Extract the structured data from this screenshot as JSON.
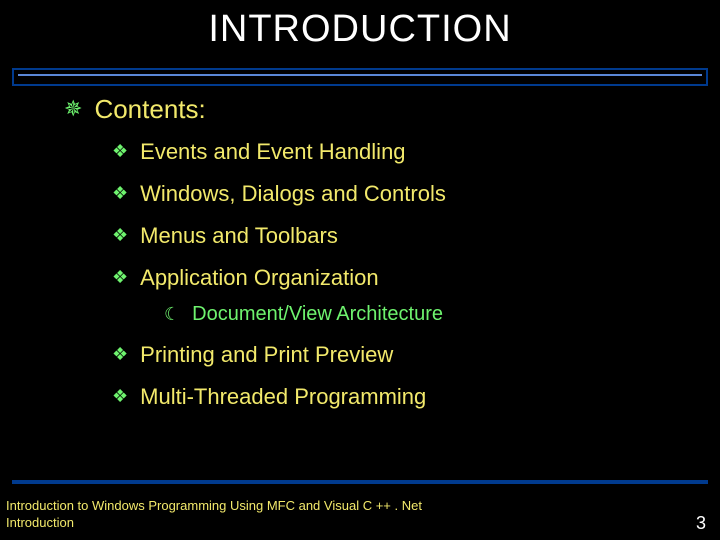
{
  "title": "INTRODUCTION",
  "heading": "Contents:",
  "items": [
    "Events and Event Handling",
    "Windows, Dialogs and Controls",
    "Menus and Toolbars",
    "Application Organization"
  ],
  "subitem": "Document/View Architecture",
  "items_after": [
    "Printing and Print Preview",
    "Multi-Threaded Programming"
  ],
  "footer_line1": "Introduction to Windows Programming Using MFC and Visual C ++ . Net",
  "footer_line2": "Introduction",
  "page_number": "3",
  "bullets": {
    "l1": "✵",
    "l2": "❖",
    "l3": "☾"
  }
}
